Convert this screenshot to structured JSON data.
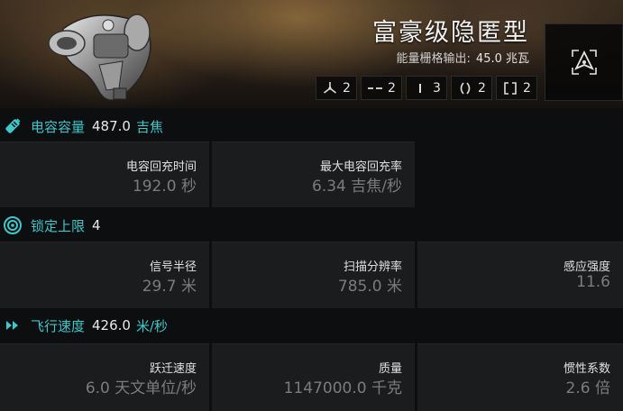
{
  "ship": {
    "name": "富豪级隐匿型",
    "power_label": "能量栅格输出:",
    "power_value": "45.0 兆瓦"
  },
  "slots": [
    {
      "icon": "turret-hardpoint-icon",
      "count": "2"
    },
    {
      "icon": "launcher-hardpoint-icon",
      "count": "2"
    },
    {
      "icon": "high-slot-icon",
      "count": "3"
    },
    {
      "icon": "mid-slot-icon",
      "count": "2"
    },
    {
      "icon": "low-slot-icon",
      "count": "2"
    }
  ],
  "capacitor": {
    "name": "电容容量",
    "value": "487.0",
    "unit": "吉焦",
    "recharge_time_label": "电容回充时间",
    "recharge_time_value": "192.0 秒",
    "max_recharge_rate_label": "最大电容回充率",
    "max_recharge_rate_value": "6.34 吉焦/秒"
  },
  "targeting": {
    "name": "锁定上限",
    "value": "4",
    "signature_radius_label": "信号半径",
    "signature_radius_value": "29.7 米",
    "scan_resolution_label": "扫描分辨率",
    "scan_resolution_value": "785.0 米",
    "sensor_strength_label": "感应强度",
    "sensor_strength_value": "11.6"
  },
  "navigation": {
    "name": "飞行速度",
    "value": "426.0",
    "unit": "米/秒",
    "warp_speed_label": "跃迁速度",
    "warp_speed_value": "6.0 天文单位/秒",
    "mass_label": "质量",
    "mass_value": "1147000.0 千克",
    "inertia_label": "惯性系数",
    "inertia_value": "2.6 倍"
  },
  "colors": {
    "accent": "#3fc7c9",
    "panel": "#1b1c1d",
    "muted_value": "#7c7c7c"
  }
}
